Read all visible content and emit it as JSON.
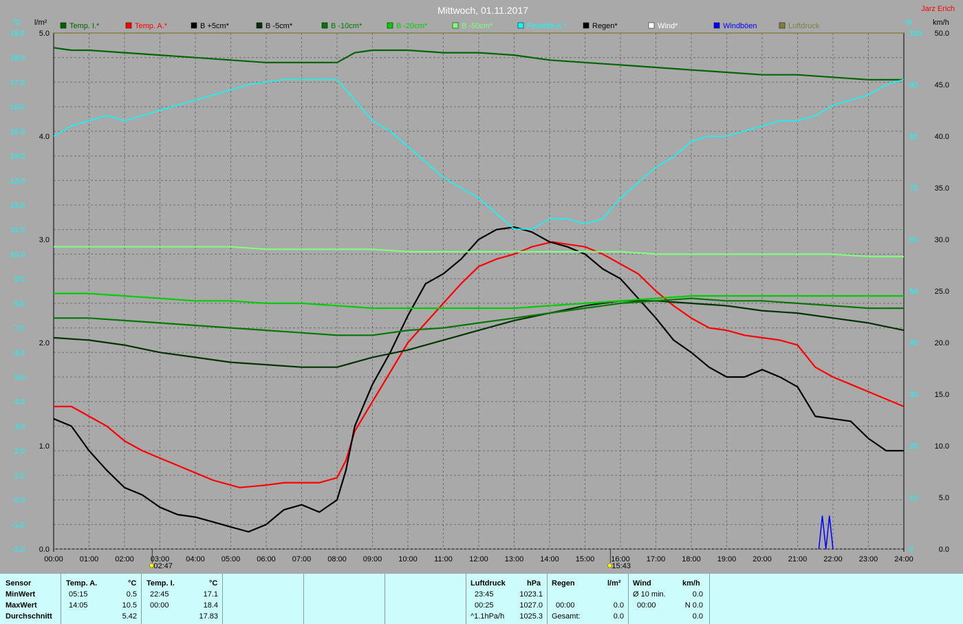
{
  "chart_data": {
    "type": "line",
    "title": "Mittwoch, 01.11.2017",
    "station": "Jarz Erich",
    "left_axis_label": "°C",
    "rain_axis_label": "l/m²",
    "right_axis_label_pct": "%",
    "right_axis_label_kmh": "km/h",
    "ylim_temp": [
      -2.0,
      19.0
    ],
    "ylim_rain": [
      0.0,
      5.0
    ],
    "ylim_kmh": [
      0.0,
      50.0
    ],
    "ylim_pct": [
      0,
      100
    ],
    "temp_ticks": [
      "19.0",
      "18.0",
      "17.0",
      "16.0",
      "15.0",
      "14.0",
      "13.0",
      "12.0",
      "11.0",
      "10.0",
      "9.0",
      "8.0",
      "7.0",
      "6.0",
      "5.0",
      "4.0",
      "3.0",
      "2.0",
      "1.0",
      "0.0",
      "-1.0",
      "-2.0"
    ],
    "rain_ticks": [
      "5.0",
      "4.0",
      "3.0",
      "2.0",
      "1.0",
      "0.0"
    ],
    "kmh_ticks": [
      "50.0",
      "45.0",
      "40.0",
      "35.0",
      "30.0",
      "25.0",
      "20.0",
      "15.0",
      "10.0",
      "5.0",
      "0.0"
    ],
    "pct_ticks": [
      "100",
      "90",
      "80",
      "70",
      "60",
      "50",
      "40",
      "30",
      "20",
      "10",
      "0"
    ],
    "x_ticks": [
      "00:00",
      "01:00",
      "02:00",
      "03:00",
      "04:00",
      "05:00",
      "06:00",
      "07:00",
      "08:00",
      "09:00",
      "10:00",
      "11:00",
      "12:00",
      "13:00",
      "14:00",
      "15:00",
      "16:00",
      "17:00",
      "18:00",
      "19:00",
      "20:00",
      "21:00",
      "22:00",
      "23:00",
      "24:00"
    ],
    "sunrise": "02:47",
    "sunset": "15:43",
    "grid": true,
    "legend_position": "top",
    "legend": [
      {
        "name": "Temp. I.*",
        "color": "#006400"
      },
      {
        "name": "Temp. A.*",
        "color": "#ff0000"
      },
      {
        "name": "B +5cm*",
        "color": "#000000"
      },
      {
        "name": "B -5cm*",
        "color": "#003300"
      },
      {
        "name": "B -10cm*",
        "color": "#007700"
      },
      {
        "name": "B -20cm*",
        "color": "#00cc00"
      },
      {
        "name": "B -50cm*",
        "color": "#80ff80"
      },
      {
        "name": "Feuchte A.*",
        "color": "#00ffff"
      },
      {
        "name": "Regen*",
        "color": "#000000"
      },
      {
        "name": "Wind*",
        "color": "#ffffff"
      },
      {
        "name": "Windböen",
        "color": "#0000ff"
      },
      {
        "name": "Luftdruck",
        "color": "#808040"
      }
    ],
    "series": [
      {
        "name": "Temp. I.*",
        "color": "#006400",
        "axis": "temp",
        "x": [
          0,
          0.5,
          1,
          2,
          3,
          4,
          5,
          6,
          7,
          8,
          8.5,
          9,
          10,
          11,
          12,
          13,
          14,
          15,
          16,
          17,
          18,
          19,
          20,
          21,
          22,
          23,
          24
        ],
        "values": [
          18.4,
          18.3,
          18.3,
          18.2,
          18.1,
          18.0,
          17.9,
          17.8,
          17.8,
          17.8,
          18.2,
          18.3,
          18.3,
          18.2,
          18.2,
          18.1,
          17.9,
          17.8,
          17.7,
          17.6,
          17.5,
          17.4,
          17.3,
          17.3,
          17.2,
          17.1,
          17.1
        ]
      },
      {
        "name": "Temp. A.*",
        "color": "#ff0000",
        "axis": "temp",
        "x": [
          0,
          0.5,
          1,
          1.5,
          2,
          2.5,
          3,
          3.5,
          4,
          4.5,
          5,
          5.25,
          6,
          6.5,
          7,
          7.5,
          8,
          8.25,
          8.5,
          9,
          9.5,
          10,
          10.5,
          11,
          11.5,
          12,
          12.5,
          13,
          13.5,
          14.08,
          14.5,
          15,
          15.5,
          16,
          16.5,
          17,
          17.5,
          18,
          18.5,
          19,
          19.5,
          20,
          20.5,
          21,
          21.5,
          22,
          22.5,
          23,
          23.5,
          24
        ],
        "values": [
          3.8,
          3.8,
          3.4,
          3.0,
          2.4,
          2.0,
          1.7,
          1.4,
          1.1,
          0.8,
          0.6,
          0.5,
          0.6,
          0.7,
          0.7,
          0.7,
          0.9,
          1.6,
          2.8,
          4.0,
          5.2,
          6.4,
          7.2,
          8.0,
          8.8,
          9.5,
          9.8,
          10.0,
          10.3,
          10.5,
          10.4,
          10.3,
          10.0,
          9.6,
          9.2,
          8.5,
          7.9,
          7.4,
          7.0,
          6.9,
          6.7,
          6.6,
          6.5,
          6.3,
          5.4,
          5.0,
          4.7,
          4.4,
          4.1,
          3.8
        ]
      },
      {
        "name": "B +5cm*",
        "color": "#000000",
        "axis": "temp",
        "x": [
          0,
          0.5,
          1,
          1.5,
          2,
          2.5,
          3,
          3.5,
          4,
          4.5,
          5,
          5.5,
          6,
          6.5,
          7,
          7.5,
          8,
          8.25,
          8.5,
          9,
          9.5,
          10,
          10.5,
          11,
          11.5,
          12,
          12.5,
          13,
          13.5,
          14,
          14.5,
          15,
          15.5,
          16,
          16.5,
          17,
          17.5,
          18,
          18.5,
          19,
          19.5,
          20,
          20.5,
          21,
          21.5,
          22,
          22.5,
          23,
          23.5,
          24
        ],
        "values": [
          3.3,
          3.0,
          2.0,
          1.2,
          0.5,
          0.2,
          -0.3,
          -0.6,
          -0.7,
          -0.9,
          -1.1,
          -1.3,
          -1.0,
          -0.4,
          -0.2,
          -0.5,
          0.0,
          1.2,
          3.0,
          4.7,
          6.0,
          7.5,
          8.8,
          9.2,
          9.8,
          10.6,
          11.0,
          11.1,
          10.9,
          10.5,
          10.3,
          10.0,
          9.4,
          9.0,
          8.2,
          7.4,
          6.5,
          6.0,
          5.4,
          5.0,
          5.0,
          5.3,
          5.0,
          4.6,
          3.4,
          3.3,
          3.2,
          2.5,
          2.0,
          2.0
        ]
      },
      {
        "name": "B -5cm*",
        "color": "#003300",
        "axis": "temp",
        "x": [
          0,
          1,
          2,
          3,
          4,
          5,
          6,
          7,
          8,
          9,
          10,
          11,
          12,
          13,
          14,
          15,
          16,
          17,
          18,
          19,
          20,
          21,
          22,
          23,
          24
        ],
        "values": [
          6.6,
          6.5,
          6.3,
          6.0,
          5.8,
          5.6,
          5.5,
          5.4,
          5.4,
          5.8,
          6.1,
          6.5,
          6.9,
          7.3,
          7.6,
          7.9,
          8.1,
          8.1,
          8.0,
          7.9,
          7.7,
          7.6,
          7.4,
          7.2,
          6.9
        ]
      },
      {
        "name": "B -10cm*",
        "color": "#007700",
        "axis": "temp",
        "x": [
          0,
          1,
          2,
          3,
          4,
          5,
          6,
          7,
          8,
          9,
          10,
          11,
          12,
          13,
          14,
          15,
          16,
          17,
          18,
          19,
          20,
          21,
          22,
          23,
          24
        ],
        "values": [
          7.4,
          7.4,
          7.3,
          7.2,
          7.1,
          7.0,
          6.9,
          6.8,
          6.7,
          6.7,
          6.9,
          7.0,
          7.2,
          7.4,
          7.6,
          7.8,
          8.0,
          8.1,
          8.2,
          8.1,
          8.1,
          8.0,
          7.9,
          7.8,
          7.8
        ]
      },
      {
        "name": "B -20cm*",
        "color": "#00cc00",
        "axis": "temp",
        "x": [
          0,
          1,
          2,
          3,
          4,
          5,
          6,
          7,
          8,
          9,
          10,
          11,
          12,
          13,
          14,
          15,
          16,
          17,
          18,
          19,
          20,
          21,
          22,
          23,
          24
        ],
        "values": [
          8.4,
          8.4,
          8.3,
          8.2,
          8.1,
          8.1,
          8.0,
          8.0,
          7.9,
          7.8,
          7.8,
          7.8,
          7.8,
          7.8,
          7.9,
          8.0,
          8.1,
          8.2,
          8.3,
          8.3,
          8.3,
          8.3,
          8.3,
          8.3,
          8.3
        ]
      },
      {
        "name": "B -50cm*",
        "color": "#80ff80",
        "axis": "temp",
        "x": [
          0,
          1,
          2,
          3,
          4,
          5,
          6,
          7,
          8,
          9,
          10,
          11,
          12,
          13,
          14,
          15,
          16,
          17,
          18,
          19,
          20,
          21,
          22,
          23,
          24
        ],
        "values": [
          10.3,
          10.3,
          10.3,
          10.3,
          10.3,
          10.3,
          10.2,
          10.2,
          10.2,
          10.2,
          10.1,
          10.1,
          10.1,
          10.1,
          10.1,
          10.1,
          10.1,
          10.0,
          10.0,
          10.0,
          10.0,
          10.0,
          10.0,
          9.9,
          9.9
        ]
      },
      {
        "name": "Feuchte A.*",
        "color": "#00ffff",
        "axis": "pct",
        "x": [
          0,
          0.5,
          1,
          1.5,
          2,
          2.5,
          3,
          3.5,
          4,
          4.5,
          5,
          5.5,
          6,
          6.5,
          7,
          7.5,
          8,
          8.5,
          9,
          9.5,
          10,
          10.5,
          11,
          11.5,
          12,
          12.5,
          13,
          13.5,
          14,
          14.5,
          15,
          15.5,
          16,
          16.5,
          17,
          17.5,
          18,
          18.5,
          19,
          19.5,
          20,
          20.5,
          21,
          21.5,
          22,
          22.5,
          23,
          23.5,
          24
        ],
        "values": [
          80,
          82,
          83,
          84,
          83,
          84,
          85,
          86,
          87,
          88,
          89,
          90,
          90.5,
          91,
          91,
          91,
          91,
          87,
          83,
          81,
          78,
          75,
          72,
          70,
          68,
          65,
          62,
          62,
          64,
          64,
          63,
          64,
          68,
          71,
          74,
          76,
          79,
          80,
          80,
          81,
          82,
          83,
          83,
          84,
          86,
          87,
          88,
          90,
          91
        ]
      },
      {
        "name": "Luftdruck",
        "color": "#808040",
        "axis": "rain_top",
        "x": [
          0,
          24
        ],
        "values": [
          5.0,
          5.0
        ]
      },
      {
        "name": "Windböen",
        "color": "#0000ff",
        "axis": "kmh",
        "x": [
          21.6,
          21.7,
          21.8,
          21.9,
          22.0
        ],
        "values": [
          0,
          3.2,
          0,
          3.2,
          0
        ]
      }
    ]
  },
  "table": {
    "headers": {
      "sensor": "Sensor",
      "temp_a": "Temp. A.",
      "temp_a_unit": "°C",
      "temp_i": "Temp. I.",
      "temp_i_unit": "°C",
      "luftdruck": "Luftdruck",
      "luftdruck_unit": "hPa",
      "regen": "Regen",
      "regen_unit": "l/m²",
      "wind": "Wind",
      "wind_unit": "km/h"
    },
    "rows": {
      "min": "MinWert",
      "max": "MaxWert",
      "avg": "Durchschnitt"
    },
    "temp_a": {
      "min_time": "05:15",
      "min_val": "0.5",
      "max_time": "14:05",
      "max_val": "10.5",
      "avg": "5.42"
    },
    "temp_i": {
      "min_time": "22:45",
      "min_val": "17.1",
      "max_time": "00:00",
      "max_val": "18.4",
      "avg": "17.83"
    },
    "luftdruck": {
      "min_time": "23:45",
      "min_val": "1023.1",
      "max_time": "00:25",
      "max_val": "1027.0",
      "trend": "^1.1hPa/h",
      "avg": "1025.3"
    },
    "regen": {
      "max_time": "00:00",
      "max_val": "0.0",
      "total_label": "Gesamt:",
      "total": "0.0"
    },
    "wind": {
      "min_label": "Ø 10 min.",
      "min_val": "0.0",
      "max_time": "00:00",
      "max_val": "N 0.0",
      "avg": "0.0"
    }
  }
}
